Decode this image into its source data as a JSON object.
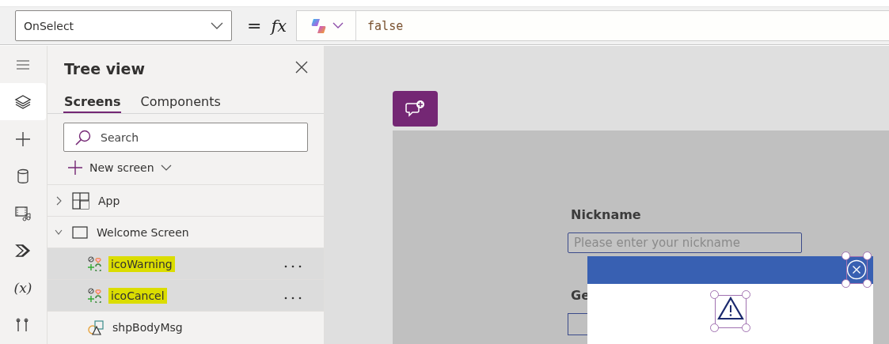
{
  "formula_bar": {
    "property": "OnSelect",
    "equals": "=",
    "fx": "fx",
    "formula": "false"
  },
  "rail": [
    {
      "kind": "menu",
      "selected": false
    },
    {
      "kind": "layers",
      "selected": true
    },
    {
      "kind": "insert",
      "selected": false
    },
    {
      "kind": "data",
      "selected": false
    },
    {
      "kind": "media",
      "selected": false
    },
    {
      "kind": "automate",
      "selected": false
    },
    {
      "kind": "variables",
      "selected": false,
      "glyph": "(x)"
    },
    {
      "kind": "tools",
      "selected": false
    }
  ],
  "tree_view": {
    "title": "Tree view",
    "tabs": [
      {
        "label": "Screens",
        "selected": true
      },
      {
        "label": "Components",
        "selected": false
      }
    ],
    "search": {
      "placeholder": "Search"
    },
    "new_screen": "New screen",
    "items": [
      {
        "kind": "app",
        "label": "App",
        "expanded": false,
        "selected": false,
        "highlighted": false
      },
      {
        "kind": "screen",
        "label": "Welcome Screen",
        "expanded": true,
        "selected": false,
        "highlighted": false,
        "children": [
          {
            "kind": "icon",
            "label": "icoWarning",
            "selected": true,
            "highlighted": true
          },
          {
            "kind": "icon",
            "label": "icoCancel",
            "selected": true,
            "highlighted": true
          },
          {
            "kind": "shape",
            "label": "shpBodyMsg",
            "selected": false,
            "highlighted": false
          }
        ]
      }
    ]
  },
  "canvas": {
    "fields": [
      {
        "label": "Nickname",
        "placeholder": "Please enter your nickname"
      },
      {
        "label": "Ge"
      }
    ],
    "popup": {
      "close_selected": true,
      "icon_selected": true
    }
  }
}
